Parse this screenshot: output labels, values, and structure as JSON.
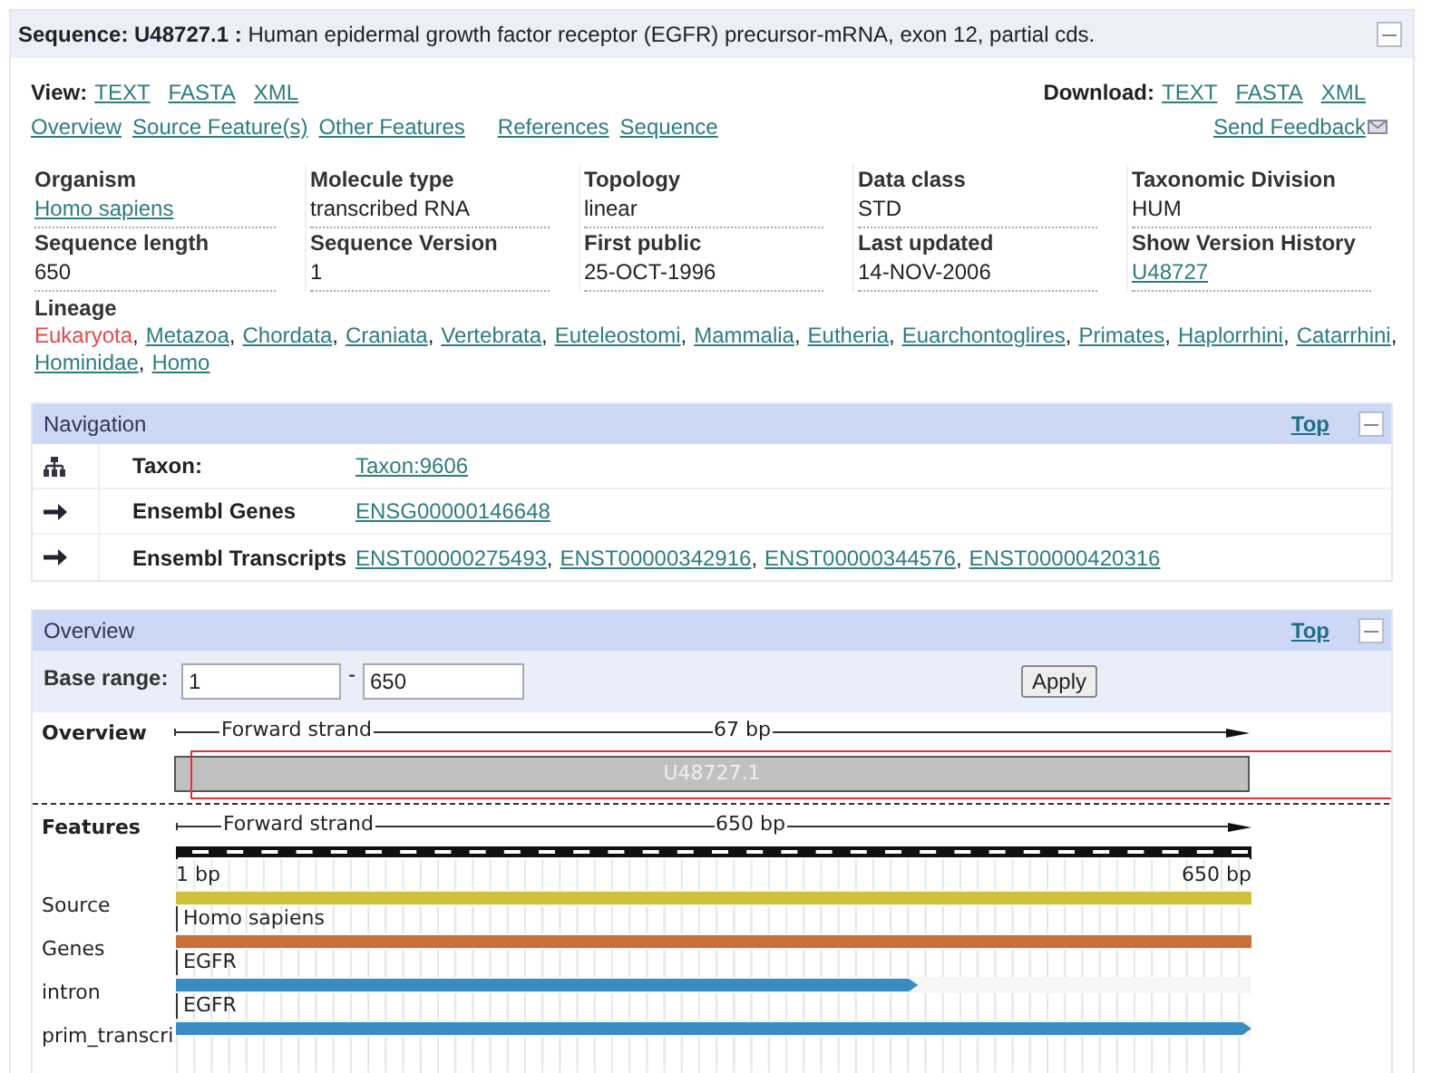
{
  "sequence_panel": {
    "title_label": "Sequence: U48727.1 :",
    "title": "Human epidermal growth factor receptor (EGFR) precursor-mRNA, exon 12, partial cds.",
    "view": {
      "label": "View:",
      "links": [
        "TEXT",
        "FASTA",
        "XML"
      ]
    },
    "download": {
      "label": "Download:",
      "links": [
        "TEXT",
        "FASTA",
        "XML"
      ]
    },
    "section_links": [
      "Overview",
      "Source Feature(s)",
      "Other Features",
      "References",
      "Sequence"
    ],
    "feedback": "Send Feedback",
    "fields": [
      {
        "label": "Organism",
        "value": "Homo sapiens",
        "link": true
      },
      {
        "label": "Molecule type",
        "value": "transcribed RNA",
        "link": false
      },
      {
        "label": "Topology",
        "value": "linear",
        "link": false
      },
      {
        "label": "Data class",
        "value": "STD",
        "link": false
      },
      {
        "label": "Taxonomic Division",
        "value": "HUM",
        "link": false
      },
      {
        "label": "Sequence length",
        "value": "650",
        "link": false
      },
      {
        "label": "Sequence Version",
        "value": "1",
        "link": false
      },
      {
        "label": "First public",
        "value": "25-OCT-1996",
        "link": false
      },
      {
        "label": "Last updated",
        "value": "14-NOV-2006",
        "link": false
      },
      {
        "label": "Show Version History",
        "value": "U48727",
        "link": true
      }
    ],
    "lineage": {
      "label": "Lineage",
      "separator": ",",
      "items": [
        {
          "name": "Eukaryota",
          "kind": "highlight"
        },
        {
          "name": "Metazoa",
          "kind": "link"
        },
        {
          "name": "Chordata",
          "kind": "link"
        },
        {
          "name": "Craniata",
          "kind": "link"
        },
        {
          "name": "Vertebrata",
          "kind": "link"
        },
        {
          "name": "Euteleostomi",
          "kind": "link"
        },
        {
          "name": "Mammalia",
          "kind": "link"
        },
        {
          "name": "Eutheria",
          "kind": "link"
        },
        {
          "name": "Euarchontoglires",
          "kind": "link"
        },
        {
          "name": "Primates",
          "kind": "link"
        },
        {
          "name": "Haplorrhini",
          "kind": "link"
        },
        {
          "name": "Catarrhini",
          "kind": "link"
        },
        {
          "name": "Hominidae",
          "kind": "link"
        },
        {
          "name": "Homo",
          "kind": "link"
        }
      ]
    }
  },
  "navigation": {
    "title": "Navigation",
    "top": "Top",
    "separator": ",",
    "rows": [
      {
        "kind": "tree",
        "label": "Taxon:",
        "links": [
          "Taxon:9606"
        ]
      },
      {
        "kind": "arrow",
        "label": "Ensembl Genes",
        "links": [
          "ENSG00000146648"
        ]
      },
      {
        "kind": "arrow",
        "label": "Ensembl Transcripts",
        "links": [
          "ENST00000275493",
          "ENST00000342916",
          "ENST00000344576",
          "ENST00000420316"
        ]
      }
    ]
  },
  "overview": {
    "title": "Overview",
    "top": "Top",
    "base_range": {
      "label": "Base range:",
      "from": "1",
      "separator": "-",
      "to": "650"
    },
    "apply": "Apply",
    "browser": {
      "overview": {
        "label": "Overview",
        "strand": "Forward strand",
        "length": "67 bp",
        "clone": "U48727.1"
      },
      "features": {
        "label": "Features",
        "strand": "Forward strand",
        "length": "650 bp",
        "start": "1 bp",
        "end": "650 bp",
        "tracks": [
          {
            "name": "Source",
            "color": "#cfc23a",
            "level": 1,
            "arrow": false,
            "feature": "Homo sapiens"
          },
          {
            "name": "Genes",
            "color": "#c87137",
            "level": 1,
            "arrow": false,
            "feature": "EGFR"
          },
          {
            "name": "intron",
            "color": "#3a8cc4",
            "level": 0.69,
            "arrow": true,
            "feature": "EGFR"
          },
          {
            "name": "prim_transcri",
            "color": "#3a8cc4",
            "level": 1,
            "arrow": true
          }
        ]
      }
    }
  }
}
